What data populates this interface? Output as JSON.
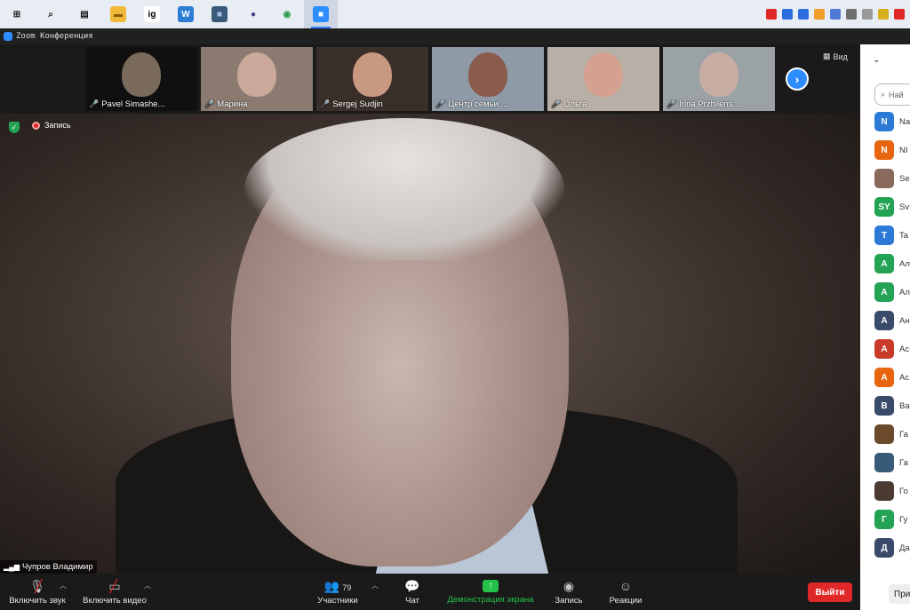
{
  "taskbar": {
    "apps": [
      {
        "name": "start-icon",
        "glyph": "⊞",
        "bg": "transparent",
        "fg": "#1a1a1a"
      },
      {
        "name": "search-icon",
        "glyph": "⌕",
        "bg": "transparent",
        "fg": "#1a1a1a"
      },
      {
        "name": "task-view-icon",
        "glyph": "▤",
        "bg": "transparent",
        "fg": "#1a1a1a"
      },
      {
        "name": "file-explorer-icon",
        "glyph": "▬",
        "bg": "#f0b93a",
        "fg": "#8a5a00"
      },
      {
        "name": "ig-app-icon",
        "glyph": "ig",
        "bg": "#ffffff",
        "fg": "#000000"
      },
      {
        "name": "word-icon",
        "glyph": "W",
        "bg": "#2b7cd3",
        "fg": "#ffffff"
      },
      {
        "name": "app-window-icon",
        "glyph": "■",
        "bg": "#3b5a7a",
        "fg": "#9fc3e8"
      },
      {
        "name": "user-app-icon",
        "glyph": "●",
        "bg": "transparent",
        "fg": "#3a3a8a"
      },
      {
        "name": "chrome-icon",
        "glyph": "◉",
        "bg": "transparent",
        "fg": "#2e9c4a"
      },
      {
        "name": "zoom-taskbar-icon",
        "glyph": "■",
        "bg": "#2d8cff",
        "fg": "#ffffff",
        "active": true
      }
    ],
    "tray": [
      {
        "name": "tray-icon-1",
        "bg": "#e02828"
      },
      {
        "name": "tray-icon-2",
        "bg": "#2d6cdf"
      },
      {
        "name": "tray-icon-3",
        "bg": "#2d6cdf"
      },
      {
        "name": "tray-icon-4",
        "bg": "#f29d2a"
      },
      {
        "name": "tray-icon-5",
        "bg": "#4f7bd6"
      },
      {
        "name": "tray-icon-6",
        "bg": "#6e6e6e"
      },
      {
        "name": "tray-icon-7",
        "bg": "#9a9a9a"
      },
      {
        "name": "tray-icon-8",
        "bg": "#d8b01e"
      },
      {
        "name": "tray-icon-9",
        "bg": "#e02828"
      }
    ]
  },
  "window": {
    "title": "Zoom Конференция"
  },
  "gallery": {
    "tiles": [
      {
        "name": "Pavel Simashe...",
        "bg": "#101010",
        "face": "#7a6a5c"
      },
      {
        "name": "Марина",
        "bg": "#8a7a70",
        "face": "#caa89a"
      },
      {
        "name": "Sergej Sudjin",
        "bg": "#3a2e28",
        "face": "#c99880"
      },
      {
        "name": "Центр семьи ...",
        "bg": "#8e9aa6",
        "face": "#8a5c4c"
      },
      {
        "name": "Ольга",
        "bg": "#b8b0a6",
        "face": "#d4a090"
      },
      {
        "name": "Irina Przhilens...",
        "bg": "#9aa2a6",
        "face": "#c8aea2"
      }
    ],
    "view_label": "Вид"
  },
  "main": {
    "recording_label": "Запись",
    "speaker_name": "Чупров Владимир"
  },
  "toolbar": {
    "audio_label": "Включить звук",
    "video_label": "Включить видео",
    "participants_label": "Участники",
    "participants_count": "79",
    "chat_label": "Чат",
    "share_label": "Демонстрация экрана",
    "record_label": "Запись",
    "reactions_label": "Реакции",
    "leave_label": "Выйти"
  },
  "panel": {
    "search_placeholder": "Най",
    "participants": [
      {
        "initial": "N",
        "label": "Na",
        "color": "#2d7ad6"
      },
      {
        "initial": "N",
        "label": "NI",
        "color": "#e8660f"
      },
      {
        "initial": "",
        "label": "Se",
        "color": "#8a6a5c"
      },
      {
        "initial": "SY",
        "label": "Sv",
        "color": "#23a353"
      },
      {
        "initial": "T",
        "label": "Ta",
        "color": "#2d7ad6"
      },
      {
        "initial": "А",
        "label": "Ал",
        "color": "#23a353"
      },
      {
        "initial": "А",
        "label": "Ал",
        "color": "#23a353"
      },
      {
        "initial": "А",
        "label": "Ан",
        "color": "#3a4a6a"
      },
      {
        "initial": "А",
        "label": "Ас",
        "color": "#c83a2a"
      },
      {
        "initial": "А",
        "label": "Ас",
        "color": "#e8660f"
      },
      {
        "initial": "В",
        "label": "Ва",
        "color": "#3a4a6a"
      },
      {
        "initial": "",
        "label": "Га",
        "color": "#6a4a2a"
      },
      {
        "initial": "",
        "label": "Га",
        "color": "#3a5a7a"
      },
      {
        "initial": "",
        "label": "Го",
        "color": "#4a3a32"
      },
      {
        "initial": "Г",
        "label": "Гу",
        "color": "#23a353"
      },
      {
        "initial": "Д",
        "label": "Да",
        "color": "#3a4a6a"
      }
    ],
    "invite_label": "При"
  }
}
